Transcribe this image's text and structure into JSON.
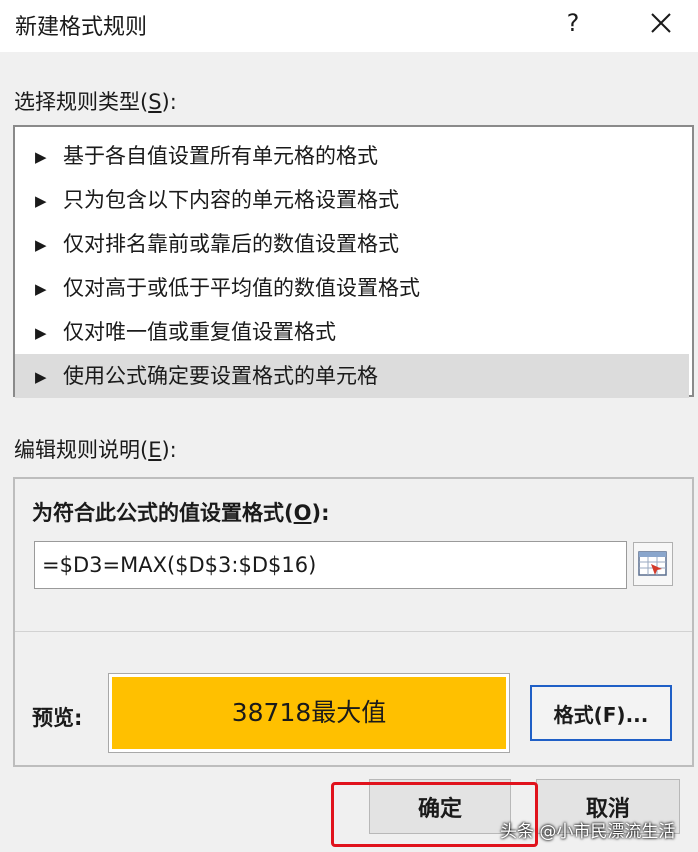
{
  "window": {
    "title": "新建格式规则",
    "help_label": "?",
    "close_icon": "close-icon"
  },
  "rule_type": {
    "label": "选择规则类型(",
    "hotkey": "S",
    "label_end": "):",
    "items": [
      {
        "label": "基于各自值设置所有单元格的格式",
        "selected": false
      },
      {
        "label": "只为包含以下内容的单元格设置格式",
        "selected": false
      },
      {
        "label": "仅对排名靠前或靠后的数值设置格式",
        "selected": false
      },
      {
        "label": "仅对高于或低于平均值的数值设置格式",
        "selected": false
      },
      {
        "label": "仅对唯一值或重复值设置格式",
        "selected": false
      },
      {
        "label": "使用公式确定要设置格式的单元格",
        "selected": true
      }
    ],
    "item_marker": "▶"
  },
  "rule_description": {
    "label": "编辑规则说明(",
    "hotkey": "E",
    "label_end": "):",
    "formula_title": "为符合此公式的值设置格式(",
    "formula_hotkey": "O",
    "formula_title_end": "):",
    "formula_value": "=$D3=MAX($D$3:$D$16)",
    "collapse_icon": "range-select-icon",
    "preview_label": "预览:",
    "preview_text": "38718最大值",
    "preview_fill": "#ffc000",
    "format_button": "格式(F)..."
  },
  "buttons": {
    "ok": "确定",
    "cancel": "取消"
  },
  "annotation": {
    "highlight_color": "#e0121c"
  },
  "watermark": "头条 @小市民漂流生活"
}
